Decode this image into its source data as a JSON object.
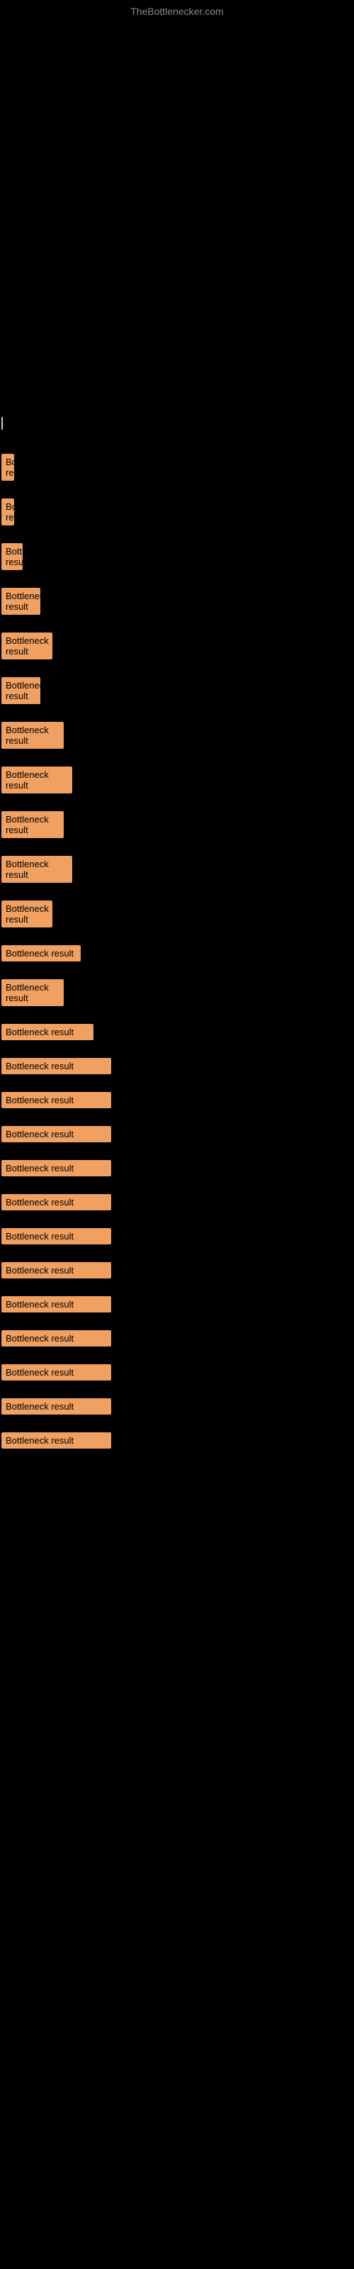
{
  "site": {
    "title": "TheBottlenecker.com"
  },
  "results": [
    {
      "id": 1,
      "label": "Bottleneck result",
      "width_class": "w-tiny"
    },
    {
      "id": 2,
      "label": "Bottleneck result",
      "width_class": "w-tiny"
    },
    {
      "id": 3,
      "label": "Bottleneck result",
      "width_class": "w-small"
    },
    {
      "id": 4,
      "label": "Bottleneck result",
      "width_class": "w-medium-small"
    },
    {
      "id": 5,
      "label": "Bottleneck result",
      "width_class": "w-medium"
    },
    {
      "id": 6,
      "label": "Bottleneck result",
      "width_class": "w-medium-small"
    },
    {
      "id": 7,
      "label": "Bottleneck result",
      "width_class": "w-medium-large"
    },
    {
      "id": 8,
      "label": "Bottleneck result",
      "width_class": "w-large"
    },
    {
      "id": 9,
      "label": "Bottleneck result",
      "width_class": "w-medium-large"
    },
    {
      "id": 10,
      "label": "Bottleneck result",
      "width_class": "w-large"
    },
    {
      "id": 11,
      "label": "Bottleneck result",
      "width_class": "w-medium"
    },
    {
      "id": 12,
      "label": "Bottleneck result",
      "width_class": "w-xlarge"
    },
    {
      "id": 13,
      "label": "Bottleneck result",
      "width_class": "w-medium-large"
    },
    {
      "id": 14,
      "label": "Bottleneck result",
      "width_class": "w-xxlarge"
    },
    {
      "id": 15,
      "label": "Bottleneck result",
      "width_class": "w-full"
    },
    {
      "id": 16,
      "label": "Bottleneck result",
      "width_class": "w-full"
    },
    {
      "id": 17,
      "label": "Bottleneck result",
      "width_class": "w-full"
    },
    {
      "id": 18,
      "label": "Bottleneck result",
      "width_class": "w-full"
    },
    {
      "id": 19,
      "label": "Bottleneck result",
      "width_class": "w-full"
    },
    {
      "id": 20,
      "label": "Bottleneck result",
      "width_class": "w-full"
    },
    {
      "id": 21,
      "label": "Bottleneck result",
      "width_class": "w-full"
    },
    {
      "id": 22,
      "label": "Bottleneck result",
      "width_class": "w-full"
    },
    {
      "id": 23,
      "label": "Bottleneck result",
      "width_class": "w-full"
    },
    {
      "id": 24,
      "label": "Bottleneck result",
      "width_class": "w-full"
    },
    {
      "id": 25,
      "label": "Bottleneck result",
      "width_class": "w-full"
    },
    {
      "id": 26,
      "label": "Bottleneck result",
      "width_class": "w-full"
    }
  ]
}
